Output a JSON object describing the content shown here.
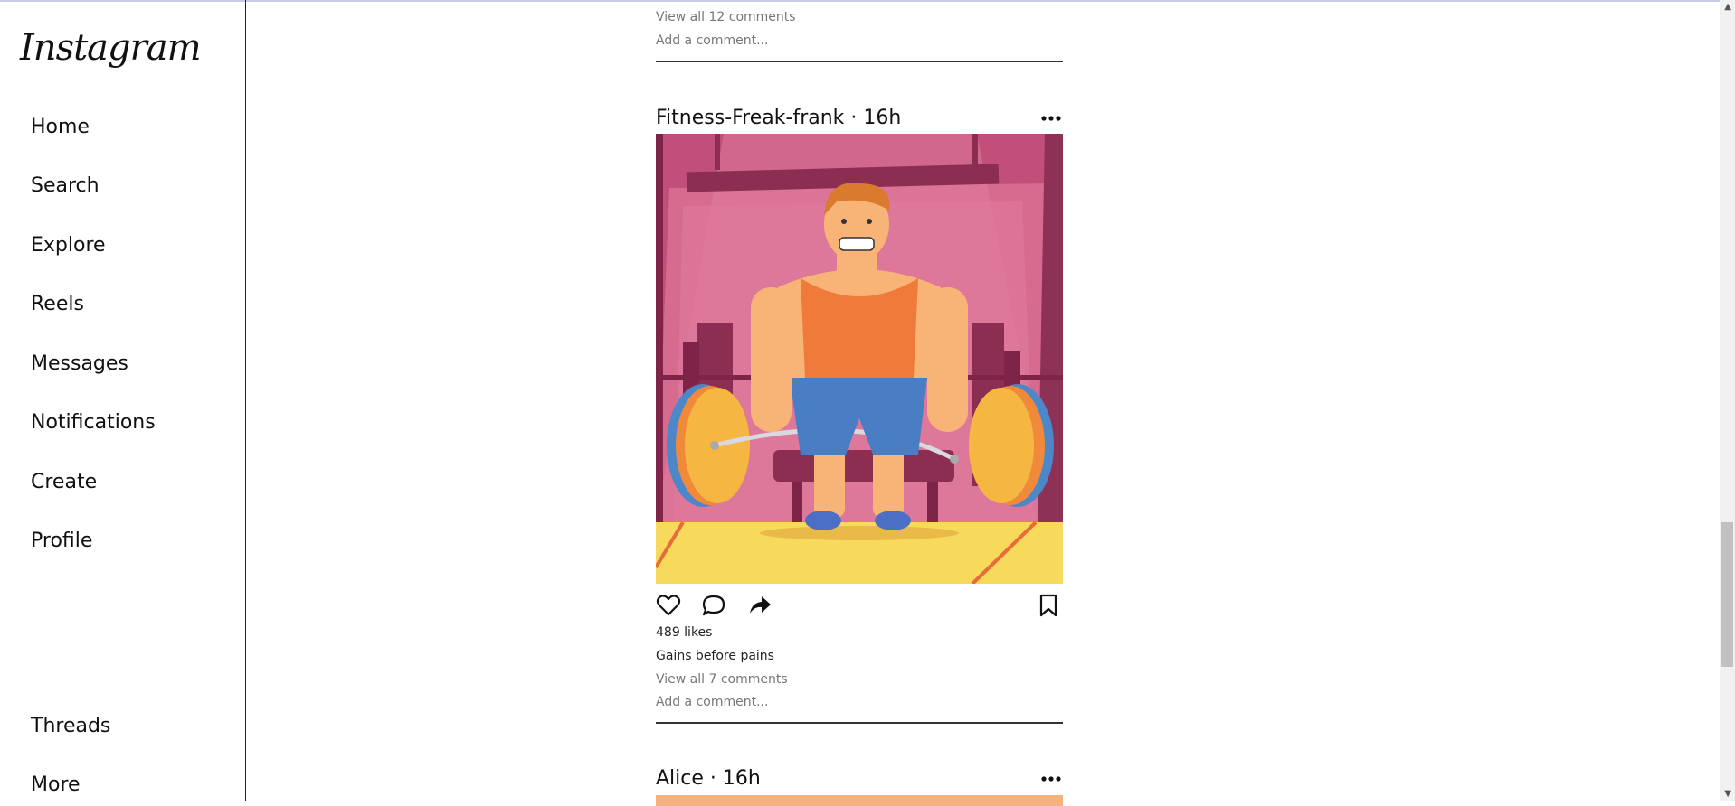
{
  "app": {
    "logo": "Instagram"
  },
  "sidebar": {
    "items": [
      {
        "label": "Home"
      },
      {
        "label": "Search"
      },
      {
        "label": "Explore"
      },
      {
        "label": "Reels"
      },
      {
        "label": "Messages"
      },
      {
        "label": "Notifications"
      },
      {
        "label": "Create"
      },
      {
        "label": "Profile"
      },
      {
        "label": "Threads"
      },
      {
        "label": "More"
      }
    ]
  },
  "feed": {
    "previous_post": {
      "view_comments": "View all 12 comments",
      "add_comment_placeholder": "Add a comment..."
    },
    "post": {
      "header": "Fitness-Freak-frank · 16h",
      "image_icon": "weightlifter-illustration",
      "likes": "489 likes",
      "caption": "Gains before pains",
      "view_comments": "View all 7 comments",
      "add_comment_placeholder": "Add a comment..."
    },
    "next_post": {
      "header": "Alice · 16h"
    }
  },
  "icons": {
    "more": "more-horizontal-icon",
    "like": "heart-icon",
    "comment": "comment-bubble-icon",
    "share": "share-arrow-icon",
    "save": "bookmark-icon"
  },
  "colors": {
    "accent_bar": "#c6cbee",
    "gym_wall": "#c8557f",
    "gym_floor": "#f7d95c"
  }
}
